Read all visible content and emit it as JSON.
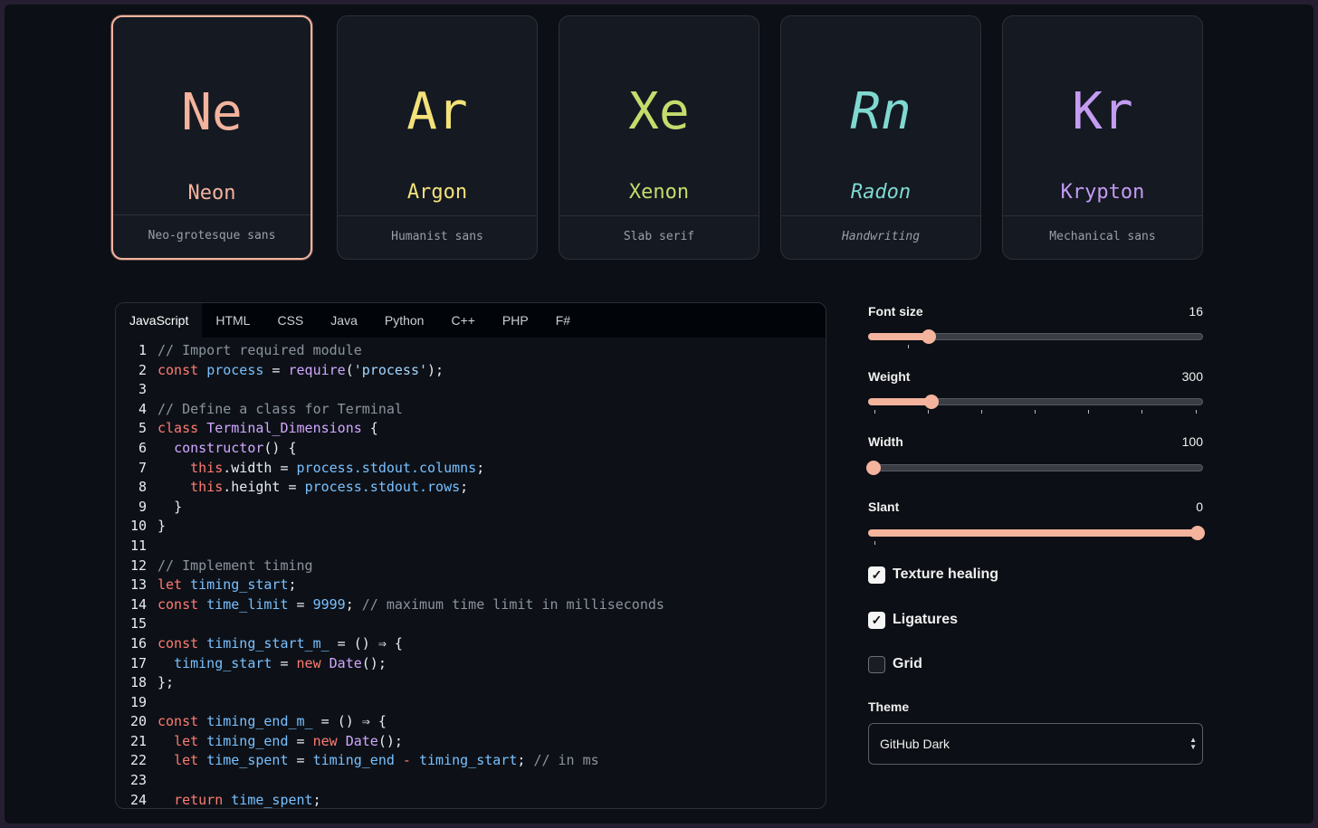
{
  "cards": [
    {
      "symbol": "Ne",
      "name": "Neon",
      "desc": "Neo-grotesque sans",
      "color": "#f3b39d",
      "selected": true
    },
    {
      "symbol": "Ar",
      "name": "Argon",
      "desc": "Humanist sans",
      "color": "#f3e27a",
      "selected": false
    },
    {
      "symbol": "Xe",
      "name": "Xenon",
      "desc": "Slab serif",
      "color": "#c3dd6c",
      "selected": false
    },
    {
      "symbol": "Rn",
      "name": "Radon",
      "desc": "Handwriting",
      "color": "#7fd9d0",
      "selected": false
    },
    {
      "symbol": "Kr",
      "name": "Krypton",
      "desc": "Mechanical sans",
      "color": "#c49cf2",
      "selected": false
    }
  ],
  "editor": {
    "tabs": [
      "JavaScript",
      "HTML",
      "CSS",
      "Java",
      "Python",
      "C++",
      "PHP",
      "F#"
    ],
    "active_tab": "JavaScript",
    "line_numbers": [
      "1",
      "2",
      "3",
      "4",
      "5",
      "6",
      "7",
      "8",
      "9",
      "10",
      "11",
      "12",
      "13",
      "14",
      "15",
      "16",
      "17",
      "18",
      "19",
      "20",
      "21",
      "22",
      "23",
      "24"
    ],
    "code": {
      "l1_comment": "// Import required module",
      "l2_const": "const",
      "l2_process": "process",
      "l2_eq": " = ",
      "l2_require": "require",
      "l2_open": "(",
      "l2_str": "'process'",
      "l2_close": ");",
      "l4_comment": "// Define a class for Terminal",
      "l5_class": "class",
      "l5_name": "Terminal_Dimensions",
      "l5_brace": " {",
      "l6_ctor": "constructor",
      "l6_rest": "() {",
      "l7_this": "this",
      "l7_prop": ".width",
      "l7_eq": " = ",
      "l7_val": "process.stdout.columns",
      "l7_end": ";",
      "l8_this": "this",
      "l8_prop": ".height",
      "l8_eq": " = ",
      "l8_val": "process.stdout.rows",
      "l8_end": ";",
      "l9_brace": "}",
      "l10_brace": "}",
      "l12_comment": "// Implement timing",
      "l13_let": "let",
      "l13_var": "timing_start",
      "l13_end": ";",
      "l14_const": "const",
      "l14_var": "time_limit",
      "l14_eq": " = ",
      "l14_num": "9999",
      "l14_semi": "; ",
      "l14_comment": "// maximum time limit in milliseconds",
      "l16_const": "const",
      "l16_var": "timing_start_m_",
      "l16_eq": " = ",
      "l16_rest": "() ⇒ {",
      "l17_var": "timing_start",
      "l17_eq": " = ",
      "l17_new": "new",
      "l17_date": "Date",
      "l17_end": "();",
      "l18_end": "};",
      "l20_const": "const",
      "l20_var": "timing_end_m_",
      "l20_eq": " = ",
      "l20_rest": "() ⇒ {",
      "l21_let": "let",
      "l21_var": "timing_end",
      "l21_eq": " = ",
      "l21_new": "new",
      "l21_date": "Date",
      "l21_end": "();",
      "l22_let": "let",
      "l22_var": "time_spent",
      "l22_eq": " = ",
      "l22_a": "timing_end",
      "l22_minus": " - ",
      "l22_b": "timing_start",
      "l22_semi": "; ",
      "l22_comment": "// in ms",
      "l24_return": "return",
      "l24_var": "time_spent",
      "l24_end": ";"
    }
  },
  "controls": {
    "font_size": {
      "label": "Font size",
      "value": "16",
      "fraction": 0.17
    },
    "weight": {
      "label": "Weight",
      "value": "300",
      "fraction": 0.18
    },
    "width": {
      "label": "Width",
      "value": "100",
      "fraction": 0.0
    },
    "slant": {
      "label": "Slant",
      "value": "0",
      "fraction": 1.0
    },
    "texture_healing": {
      "label": "Texture healing",
      "checked": true
    },
    "ligatures": {
      "label": "Ligatures",
      "checked": true
    },
    "grid": {
      "label": "Grid",
      "checked": false
    },
    "theme": {
      "label": "Theme",
      "value": "GitHub Dark"
    }
  },
  "colors": {
    "accent": "#f3b39d",
    "background": "#0c0f15"
  }
}
